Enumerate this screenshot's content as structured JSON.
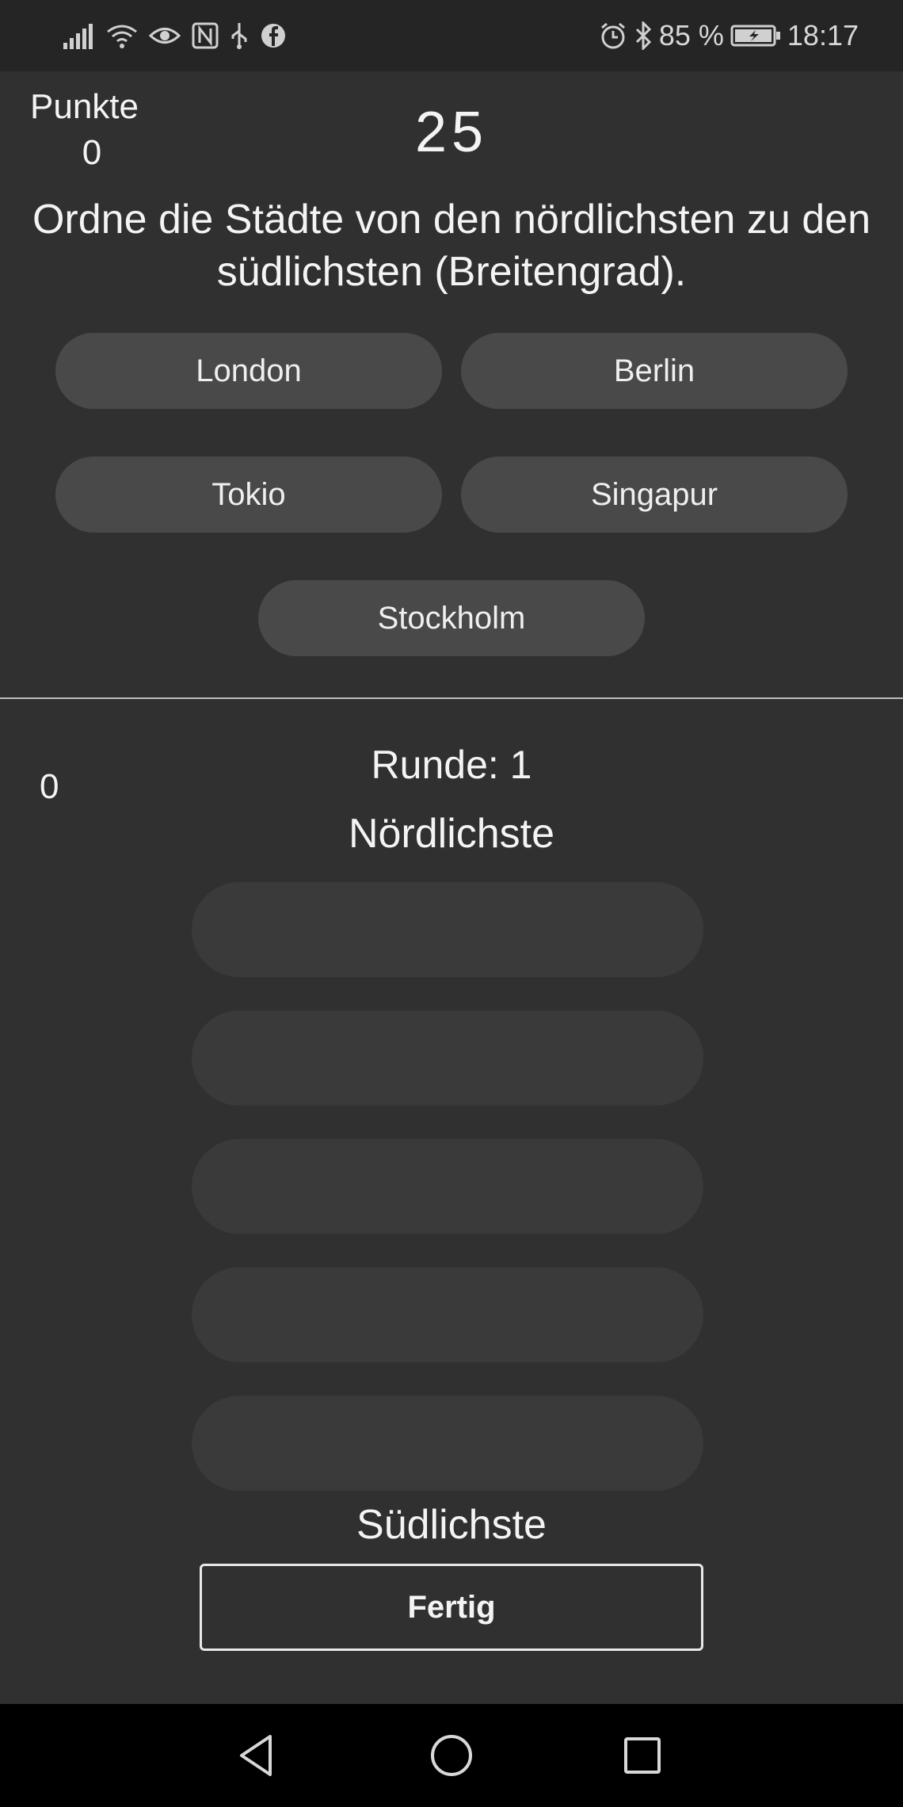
{
  "status_bar": {
    "battery": "85 %",
    "time": "18:17",
    "icons_left": [
      "signal-icon",
      "wifi-icon",
      "eye-icon",
      "nfc-icon",
      "usb-icon",
      "facebook-icon"
    ],
    "icons_right": [
      "alarm-icon",
      "bluetooth-icon",
      "battery-charging-icon"
    ]
  },
  "header": {
    "points_label": "Punkte",
    "points_value": "0",
    "timer": "25"
  },
  "question": "Ordne die Städte von den nördlichsten zu den südlichsten (Breitengrad).",
  "cities": [
    "London",
    "Berlin",
    "Tokio",
    "Singapur",
    "Stockholm"
  ],
  "game": {
    "counter": "0",
    "round_label": "Runde: 1",
    "north_label": "Nördlichste",
    "south_label": "Südlichste",
    "slot_count": 5
  },
  "done_label": "Fertig",
  "nav": [
    "back-icon",
    "home-icon",
    "recent-apps-icon"
  ],
  "colors": {
    "background": "#303030",
    "status_bar": "#252525",
    "button": "#494949",
    "slot": "#3a3a3a",
    "text": "#f4f4f4"
  }
}
